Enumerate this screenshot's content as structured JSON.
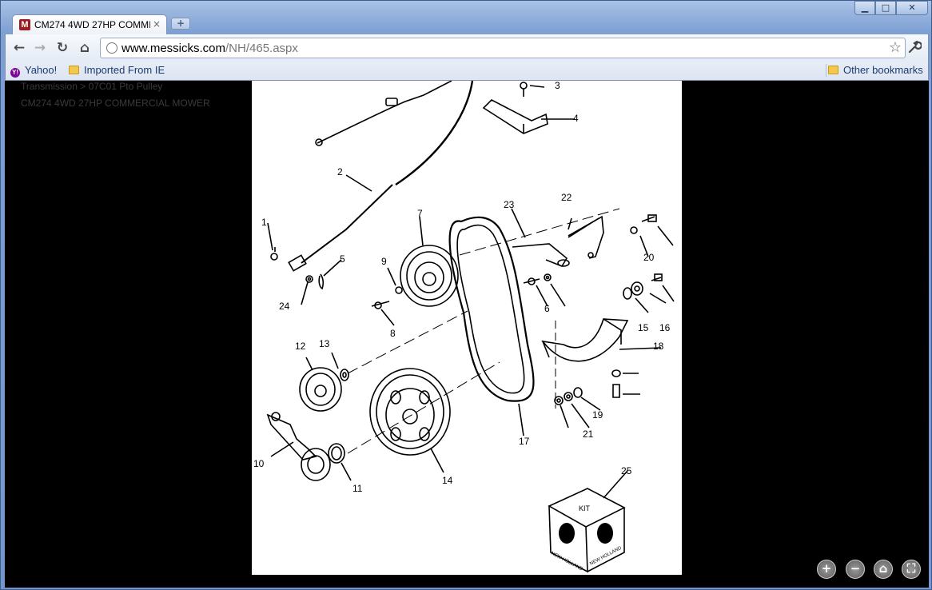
{
  "window": {
    "tab_title": "CM274 4WD 27HP COMMI",
    "favicon_letter": "M",
    "tab_close": "×",
    "new_tab": "+",
    "controls": {
      "minimize": "▁",
      "maximize": "□",
      "close": "✕"
    }
  },
  "toolbar": {
    "back": "←",
    "forward": "→",
    "reload": "↻",
    "home": "⌂",
    "url_host": "www.messicks.com",
    "url_path": "/NH/465.aspx",
    "star": "☆",
    "wrench": "🔧"
  },
  "bookmarks": {
    "yahoo_icon": "Y!",
    "yahoo": "Yahoo!",
    "imported": "Imported From IE",
    "other": "Other bookmarks"
  },
  "page": {
    "breadcrumb": "Transmission > 07C01 Pto Pulley",
    "model": "CM274 4WD 27HP COMMERCIAL MOWER"
  },
  "diagram": {
    "callouts": [
      "1",
      "2",
      "3",
      "4",
      "5",
      "6",
      "7",
      "8",
      "9",
      "10",
      "11",
      "12",
      "13",
      "14",
      "15",
      "16",
      "17",
      "18",
      "19",
      "20",
      "21",
      "22",
      "23",
      "24",
      "25"
    ],
    "kit_label": "KIT",
    "brand": "NEW HOLLAND"
  },
  "zoom": {
    "zoom_in": "+",
    "zoom_out": "−",
    "home": "⌂",
    "fullscreen": "⛶"
  }
}
